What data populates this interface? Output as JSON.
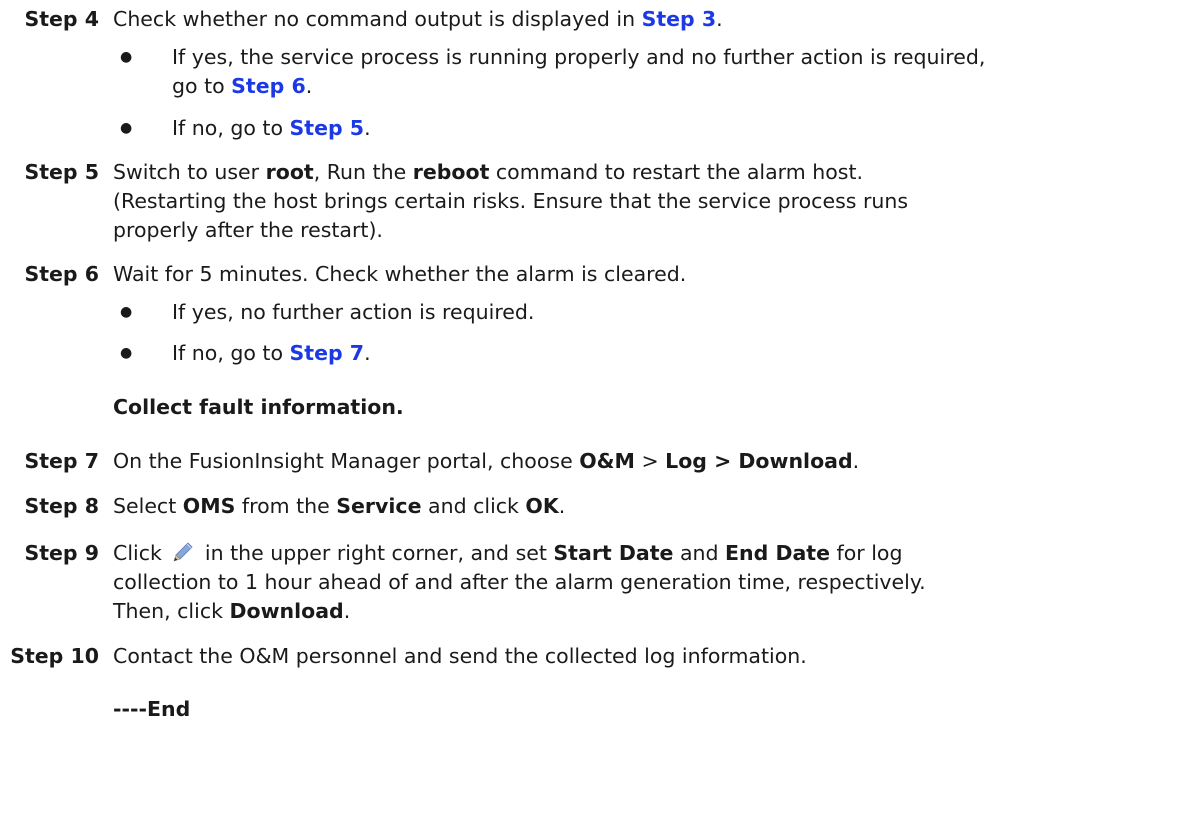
{
  "steps": {
    "s4": {
      "label": "Step 4",
      "text1": "Check whether no command output is displayed in ",
      "link": "Step 3",
      "text2": ".",
      "b1_text1": "If yes, the service process is running properly and no further action is required,",
      "b1_text2": "go to ",
      "b1_link": "Step 6",
      "b1_text3": ".",
      "b2_text1": "If no, go to ",
      "b2_link": "Step 5",
      "b2_text2": "."
    },
    "s5": {
      "label": "Step 5",
      "t1": "Switch to user ",
      "b1": "root",
      "t2": ", Run the ",
      "b2": "reboot",
      "t3": " command to restart the alarm host.",
      "line2": "(Restarting the host brings certain risks. Ensure that the service process runs",
      "line3": "properly after the restart)."
    },
    "s6": {
      "label": "Step 6",
      "text": "Wait for 5 minutes. Check whether the alarm is cleared.",
      "b1": "If yes, no further action is required.",
      "b2_text1": "If no, go to ",
      "b2_link": "Step 7",
      "b2_text2": "."
    },
    "section_heading": "Collect fault information.",
    "s7": {
      "label": "Step 7",
      "t1": "On the FusionInsight Manager portal, choose ",
      "b1": "O&M",
      "t2": " > ",
      "b2": "Log > Download",
      "t3": "."
    },
    "s8": {
      "label": "Step 8",
      "t1": "Select ",
      "b1": "OMS",
      "t2": " from the ",
      "b2": "Service",
      "t3": " and click ",
      "b3": "OK",
      "t4": "."
    },
    "s9": {
      "label": "Step 9",
      "t1": "Click",
      "t2": "in the upper right corner, and set ",
      "b1": "Start Date",
      "t3": " and ",
      "b2": "End Date",
      "t4": " for log",
      "line2": "collection to 1 hour ahead of and after the alarm generation time, respectively.",
      "line3_t1": "Then, click ",
      "line3_b1": "Download",
      "line3_t2": "."
    },
    "s10": {
      "label": "Step 10",
      "text": "Contact the O&M personnel and send the collected log information."
    },
    "end": "----End"
  },
  "bullet_char": "●",
  "icons": {
    "edit": "pencil-icon"
  },
  "colors": {
    "link": "#1c39e6",
    "text": "#1a1a1a"
  }
}
